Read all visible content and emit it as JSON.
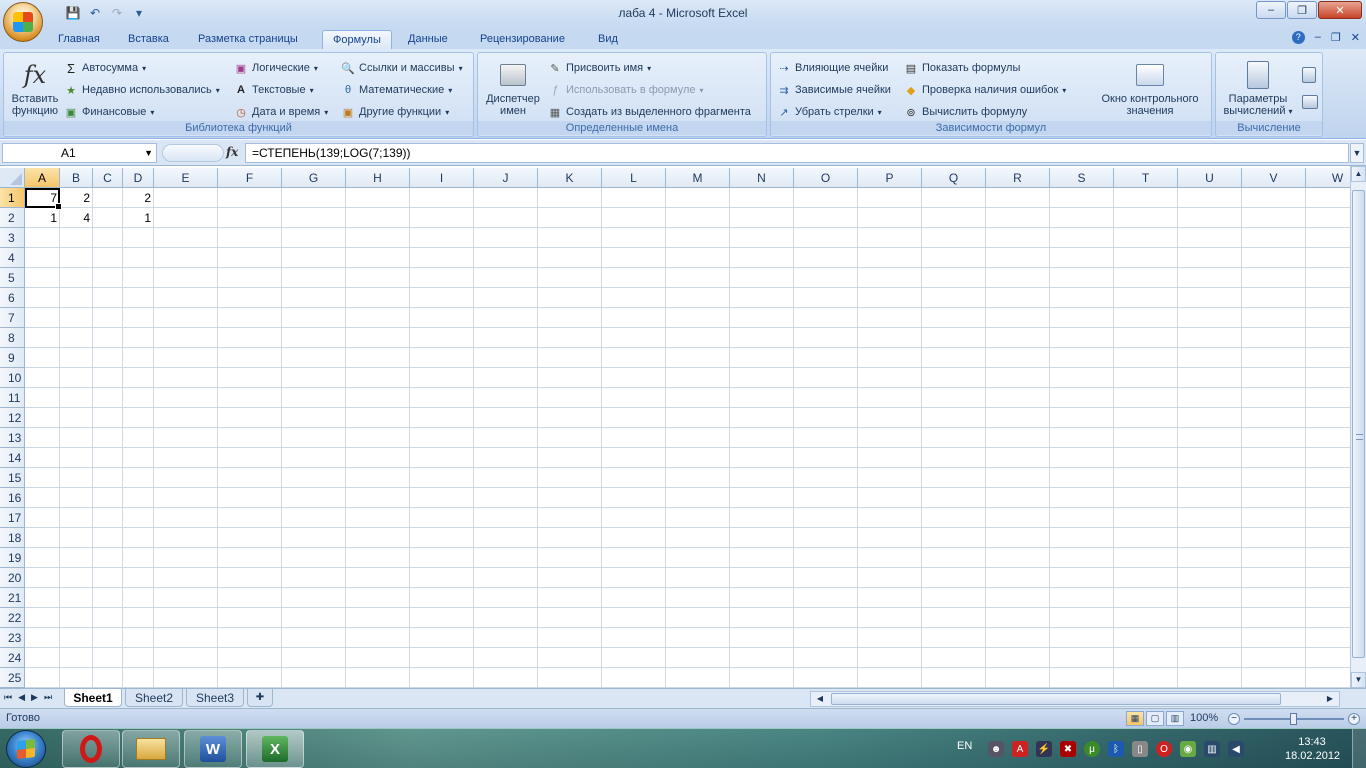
{
  "window": {
    "title": "лаба 4 - Microsoft Excel",
    "controls": {
      "minimize": "–",
      "maximize": "❐",
      "close": "✕"
    }
  },
  "qat": {
    "save_icon": "💾",
    "undo_icon": "↶",
    "redo_icon": "↷",
    "customize_icon": "▾"
  },
  "tabs": [
    {
      "label": "Главная"
    },
    {
      "label": "Вставка"
    },
    {
      "label": "Разметка страницы"
    },
    {
      "label": "Формулы"
    },
    {
      "label": "Данные"
    },
    {
      "label": "Рецензирование"
    },
    {
      "label": "Вид"
    }
  ],
  "active_tab": "Формулы",
  "ribbon": {
    "function_library": {
      "label": "Библиотека функций",
      "insert_function": "Вставить функцию",
      "insert_function_l1": "Вставить",
      "insert_function_l2": "функцию",
      "autosum": "Автосумма",
      "recent": "Недавно использовались",
      "financial": "Финансовые",
      "logical": "Логические",
      "text": "Текстовые",
      "datetime": "Дата и время",
      "lookup": "Ссылки и массивы",
      "math": "Математические",
      "more": "Другие функции"
    },
    "defined_names": {
      "label": "Определенные имена",
      "name_manager_l1": "Диспетчер",
      "name_manager_l2": "имен",
      "define_name": "Присвоить имя",
      "use_in_formula": "Использовать в формуле",
      "create_from_selection": "Создать из выделенного фрагмента"
    },
    "formula_auditing": {
      "label": "Зависимости формул",
      "trace_precedents": "Влияющие ячейки",
      "trace_dependents": "Зависимые ячейки",
      "remove_arrows": "Убрать стрелки",
      "show_formulas": "Показать формулы",
      "error_checking": "Проверка наличия ошибок",
      "evaluate_formula": "Вычислить формулу",
      "watch_window_l1": "Окно контрольного",
      "watch_window_l2": "значения"
    },
    "calculation": {
      "label": "Вычисление",
      "options_l1": "Параметры",
      "options_l2": "вычислений"
    }
  },
  "formula_bar": {
    "name_box": "A1",
    "fx": "fx",
    "formula": "=СТЕПЕНЬ(139;LOG(7;139))"
  },
  "sheet": {
    "columns": [
      "A",
      "B",
      "C",
      "D",
      "E",
      "F",
      "G",
      "H",
      "I",
      "J",
      "K",
      "L",
      "M",
      "N",
      "O",
      "P",
      "Q",
      "R",
      "S",
      "T",
      "U",
      "V",
      "W"
    ],
    "rows": [
      "1",
      "2",
      "3",
      "4",
      "5",
      "6",
      "7",
      "8",
      "9",
      "10",
      "11",
      "12",
      "13",
      "14",
      "15",
      "16",
      "17",
      "18",
      "19",
      "20",
      "21",
      "22",
      "23",
      "24",
      "25"
    ],
    "active_cell": "A1",
    "cells": {
      "A1": "7",
      "B1": "2",
      "D1": "2",
      "A2": "1",
      "B2": "4",
      "D2": "1"
    }
  },
  "sheet_tabs": [
    "Sheet1",
    "Sheet2",
    "Sheet3"
  ],
  "active_sheet": "Sheet1",
  "status": {
    "ready": "Готово",
    "zoom": "100%"
  },
  "taskbar": {
    "lang": "EN",
    "time": "13:43",
    "date": "18.02.2012",
    "apps": [
      "opera-icon",
      "explorer-icon",
      "word-icon",
      "excel-icon"
    ]
  }
}
